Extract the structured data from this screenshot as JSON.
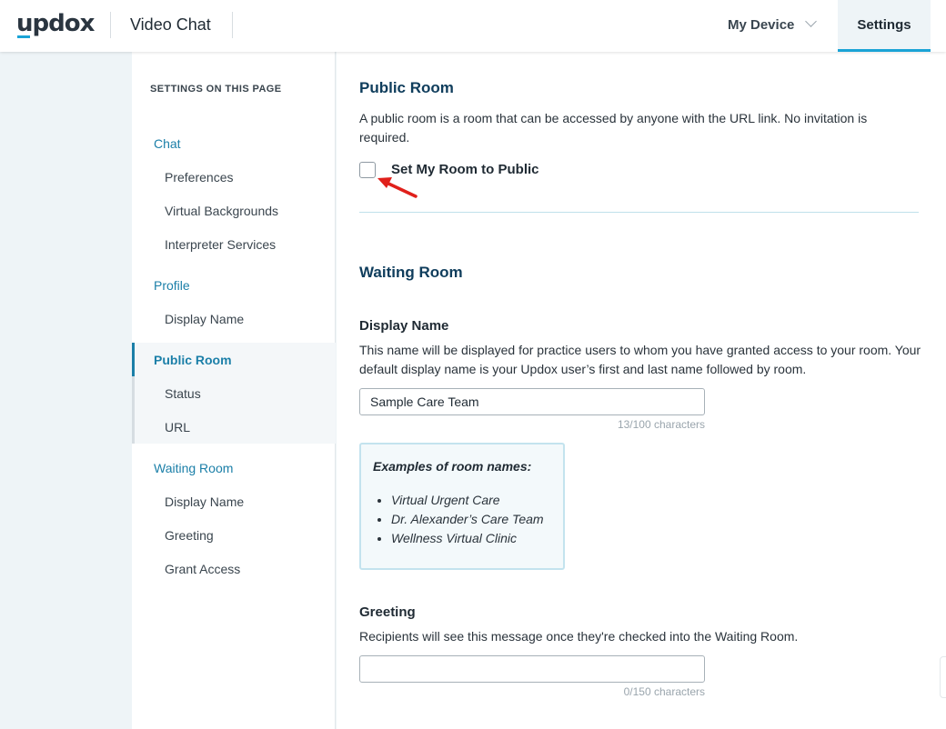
{
  "header": {
    "logo": "updox",
    "app_title": "Video Chat",
    "device_menu": "My Device",
    "settings_tab": "Settings"
  },
  "sidebar": {
    "heading": "SETTINGS ON THIS PAGE",
    "sections": [
      {
        "label": "Chat",
        "items": [
          "Preferences",
          "Virtual Backgrounds",
          "Interpreter Services"
        ]
      },
      {
        "label": "Profile",
        "items": [
          "Display Name"
        ]
      },
      {
        "label": "Public Room",
        "items": [
          "Status",
          "URL"
        ],
        "active": true
      },
      {
        "label": "Waiting Room",
        "items": [
          "Display Name",
          "Greeting",
          "Grant Access"
        ]
      }
    ]
  },
  "main": {
    "public_room": {
      "title": "Public Room",
      "description": "A public room is a room that can be accessed by anyone with the URL link. No invitation is required.",
      "checkbox_label": "Set My Room to Public",
      "checked": false
    },
    "waiting_room": {
      "title": "Waiting Room",
      "display_name": {
        "title": "Display Name",
        "description": "This name will be displayed for practice users to whom you have granted access to your room. Your default display name is your Updox user’s first and last name followed by room.",
        "value": "Sample Care Team",
        "char_count": "13/100 characters"
      },
      "examples": {
        "title": "Examples of room names:",
        "items": [
          "Virtual Urgent Care",
          "Dr. Alexander’s Care Team",
          "Wellness Virtual Clinic"
        ]
      },
      "greeting": {
        "title": "Greeting",
        "description": "Recipients will see this message once they're checked into the Waiting Room.",
        "value": "",
        "char_count": "0/150 characters"
      }
    }
  },
  "colors": {
    "accent": "#1aa3d6",
    "link": "#1b7fa8",
    "section_title": "#0f3d5c",
    "annotation_arrow": "#e0201b"
  }
}
